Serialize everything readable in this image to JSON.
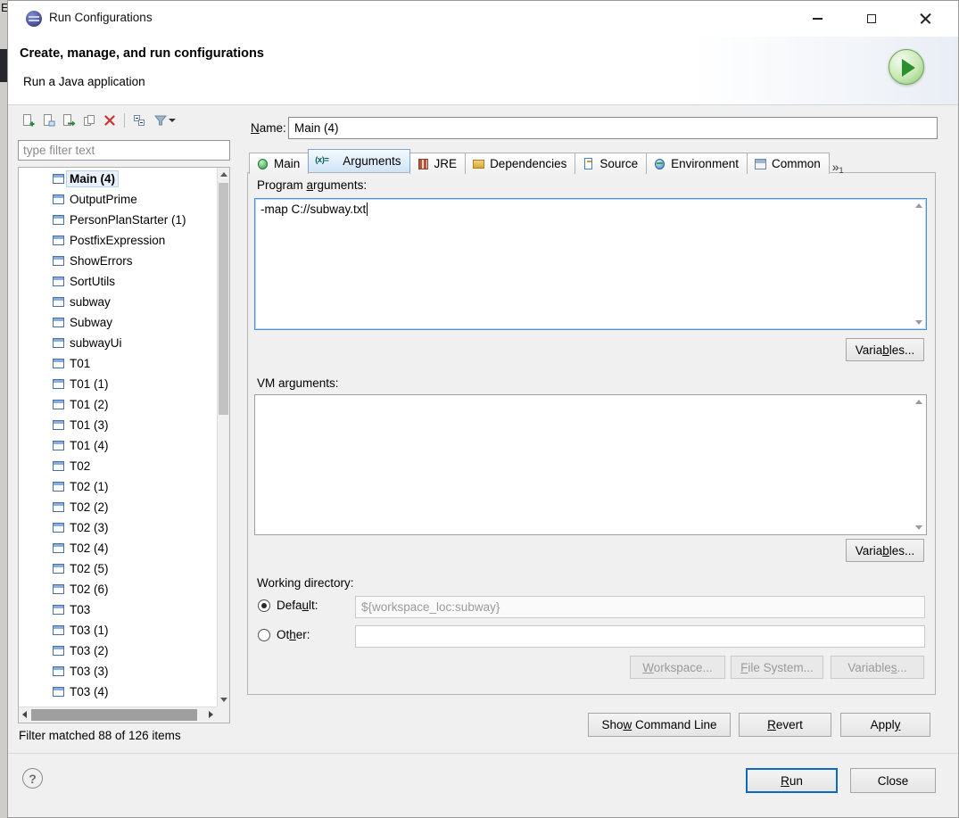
{
  "background_edge": {
    "text": "E"
  },
  "window": {
    "title": "Run Configurations"
  },
  "header": {
    "title": "Create, manage, and run configurations",
    "subtitle": "Run a Java application"
  },
  "left_panel": {
    "toolbar_icons": [
      "new-configuration",
      "new-prototype",
      "export",
      "duplicate",
      "delete",
      "collapse-all",
      "filter-menu"
    ],
    "filter_placeholder": "type filter text",
    "selected_index": 0,
    "tree_items": [
      "Main (4)",
      "OutputPrime",
      "PersonPlanStarter (1)",
      "PostfixExpression",
      "ShowErrors",
      "SortUtils",
      "subway",
      "Subway",
      "subwayUi",
      "T01",
      "T01 (1)",
      "T01 (2)",
      "T01 (3)",
      "T01 (4)",
      "T02",
      "T02 (1)",
      "T02 (2)",
      "T02 (3)",
      "T02 (4)",
      "T02 (5)",
      "T02 (6)",
      "T03",
      "T03 (1)",
      "T03 (2)",
      "T03 (3)",
      "T03 (4)"
    ],
    "status": "Filter matched 88 of 126 items"
  },
  "right_panel": {
    "name_label": {
      "text": "Name:",
      "u": 0
    },
    "name_value": "Main (4)",
    "tabs": [
      {
        "label": "Main",
        "icon": "main",
        "selected": false
      },
      {
        "label": "Arguments",
        "icon": "arguments",
        "selected": true
      },
      {
        "label": "JRE",
        "icon": "jre",
        "selected": false
      },
      {
        "label": "Dependencies",
        "icon": "dependencies",
        "selected": false
      },
      {
        "label": "Source",
        "icon": "source",
        "selected": false
      },
      {
        "label": "Environment",
        "icon": "environment",
        "selected": false
      },
      {
        "label": "Common",
        "icon": "common",
        "selected": false
      }
    ],
    "tab_overflow": {
      "chevron": "»",
      "count": "1"
    },
    "program_arguments": {
      "label": {
        "text": "Program arguments:",
        "u": 8
      },
      "value": "-map C://subway.txt",
      "variables_button": {
        "text": "Variables...",
        "u": 5
      }
    },
    "vm_arguments": {
      "label": {
        "text": "VM arguments:",
        "u": 5
      },
      "value": "",
      "variables_button": {
        "text": "Variables...",
        "u": 5
      }
    },
    "working_directory": {
      "label": "Working directory:",
      "default_radio": {
        "text": "Default:",
        "u": 4
      },
      "default_value": "${workspace_loc:subway}",
      "other_radio": {
        "text": "Other:",
        "u": 2
      },
      "other_value": "",
      "workspace_button": {
        "text": "Workspace...",
        "u": 0
      },
      "file_system_button": {
        "text": "File System...",
        "u": 0
      },
      "variables_button": {
        "text": "Variables...",
        "u": 8
      }
    },
    "actions": {
      "show_command_line": {
        "text": "Show Command Line",
        "u": 3
      },
      "revert": {
        "text": "Revert",
        "u": 0
      },
      "apply": {
        "text": "Apply",
        "u": 4
      }
    }
  },
  "footer": {
    "help_label": "?",
    "run_button": {
      "text": "Run",
      "u": 0
    },
    "close_label": "Close"
  }
}
